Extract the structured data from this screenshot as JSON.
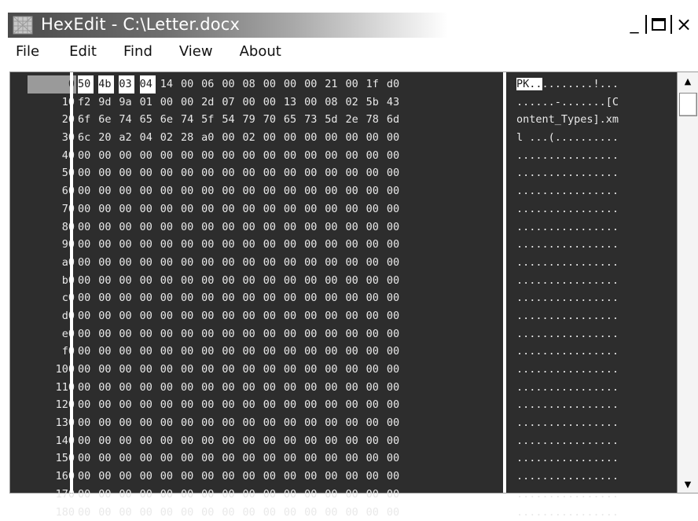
{
  "window": {
    "title": "HexEdit - C:\\Letter.docx",
    "minimize_label": "_",
    "close_label": "×"
  },
  "menu": {
    "items": [
      "File",
      "Edit",
      "Find",
      "View",
      "About"
    ]
  },
  "offsets": [
    "0",
    "10",
    "20",
    "30",
    "40",
    "50",
    "60",
    "70",
    "80",
    "90",
    "a0",
    "b0",
    "c0",
    "d0",
    "e0",
    "f0",
    "100",
    "110",
    "120",
    "130",
    "140",
    "150",
    "160",
    "170",
    "180"
  ],
  "hex_rows": [
    [
      "50",
      "4b",
      "03",
      "04",
      "14",
      "00",
      "06",
      "00",
      "08",
      "00",
      "00",
      "00",
      "21",
      "00",
      "1f",
      "d0"
    ],
    [
      "f2",
      "9d",
      "9a",
      "01",
      "00",
      "00",
      "2d",
      "07",
      "00",
      "00",
      "13",
      "00",
      "08",
      "02",
      "5b",
      "43"
    ],
    [
      "6f",
      "6e",
      "74",
      "65",
      "6e",
      "74",
      "5f",
      "54",
      "79",
      "70",
      "65",
      "73",
      "5d",
      "2e",
      "78",
      "6d"
    ],
    [
      "6c",
      "20",
      "a2",
      "04",
      "02",
      "28",
      "a0",
      "00",
      "02",
      "00",
      "00",
      "00",
      "00",
      "00",
      "00",
      "00"
    ],
    [
      "00",
      "00",
      "00",
      "00",
      "00",
      "00",
      "00",
      "00",
      "00",
      "00",
      "00",
      "00",
      "00",
      "00",
      "00",
      "00"
    ],
    [
      "00",
      "00",
      "00",
      "00",
      "00",
      "00",
      "00",
      "00",
      "00",
      "00",
      "00",
      "00",
      "00",
      "00",
      "00",
      "00"
    ],
    [
      "00",
      "00",
      "00",
      "00",
      "00",
      "00",
      "00",
      "00",
      "00",
      "00",
      "00",
      "00",
      "00",
      "00",
      "00",
      "00"
    ],
    [
      "00",
      "00",
      "00",
      "00",
      "00",
      "00",
      "00",
      "00",
      "00",
      "00",
      "00",
      "00",
      "00",
      "00",
      "00",
      "00"
    ],
    [
      "00",
      "00",
      "00",
      "00",
      "00",
      "00",
      "00",
      "00",
      "00",
      "00",
      "00",
      "00",
      "00",
      "00",
      "00",
      "00"
    ],
    [
      "00",
      "00",
      "00",
      "00",
      "00",
      "00",
      "00",
      "00",
      "00",
      "00",
      "00",
      "00",
      "00",
      "00",
      "00",
      "00"
    ],
    [
      "00",
      "00",
      "00",
      "00",
      "00",
      "00",
      "00",
      "00",
      "00",
      "00",
      "00",
      "00",
      "00",
      "00",
      "00",
      "00"
    ],
    [
      "00",
      "00",
      "00",
      "00",
      "00",
      "00",
      "00",
      "00",
      "00",
      "00",
      "00",
      "00",
      "00",
      "00",
      "00",
      "00"
    ],
    [
      "00",
      "00",
      "00",
      "00",
      "00",
      "00",
      "00",
      "00",
      "00",
      "00",
      "00",
      "00",
      "00",
      "00",
      "00",
      "00"
    ],
    [
      "00",
      "00",
      "00",
      "00",
      "00",
      "00",
      "00",
      "00",
      "00",
      "00",
      "00",
      "00",
      "00",
      "00",
      "00",
      "00"
    ],
    [
      "00",
      "00",
      "00",
      "00",
      "00",
      "00",
      "00",
      "00",
      "00",
      "00",
      "00",
      "00",
      "00",
      "00",
      "00",
      "00"
    ],
    [
      "00",
      "00",
      "00",
      "00",
      "00",
      "00",
      "00",
      "00",
      "00",
      "00",
      "00",
      "00",
      "00",
      "00",
      "00",
      "00"
    ],
    [
      "00",
      "00",
      "00",
      "00",
      "00",
      "00",
      "00",
      "00",
      "00",
      "00",
      "00",
      "00",
      "00",
      "00",
      "00",
      "00"
    ],
    [
      "00",
      "00",
      "00",
      "00",
      "00",
      "00",
      "00",
      "00",
      "00",
      "00",
      "00",
      "00",
      "00",
      "00",
      "00",
      "00"
    ],
    [
      "00",
      "00",
      "00",
      "00",
      "00",
      "00",
      "00",
      "00",
      "00",
      "00",
      "00",
      "00",
      "00",
      "00",
      "00",
      "00"
    ],
    [
      "00",
      "00",
      "00",
      "00",
      "00",
      "00",
      "00",
      "00",
      "00",
      "00",
      "00",
      "00",
      "00",
      "00",
      "00",
      "00"
    ],
    [
      "00",
      "00",
      "00",
      "00",
      "00",
      "00",
      "00",
      "00",
      "00",
      "00",
      "00",
      "00",
      "00",
      "00",
      "00",
      "00"
    ],
    [
      "00",
      "00",
      "00",
      "00",
      "00",
      "00",
      "00",
      "00",
      "00",
      "00",
      "00",
      "00",
      "00",
      "00",
      "00",
      "00"
    ],
    [
      "00",
      "00",
      "00",
      "00",
      "00",
      "00",
      "00",
      "00",
      "00",
      "00",
      "00",
      "00",
      "00",
      "00",
      "00",
      "00"
    ],
    [
      "00",
      "00",
      "00",
      "00",
      "00",
      "00",
      "00",
      "00",
      "00",
      "00",
      "00",
      "00",
      "00",
      "00",
      "00",
      "00"
    ],
    [
      "00",
      "00",
      "00",
      "00",
      "00",
      "00",
      "00",
      "00",
      "00",
      "00",
      "00",
      "00",
      "00",
      "00",
      "00",
      "00"
    ]
  ],
  "ascii_rows": [
    "PK..........!...",
    "......-.......[C",
    "ontent_Types].xm",
    "l ...(..........",
    "................",
    "................",
    "................",
    "................",
    "................",
    "................",
    "................",
    "................",
    "................",
    "................",
    "................",
    "................",
    "................",
    "................",
    "................",
    "................",
    "................",
    "................",
    "................",
    "................",
    "................"
  ],
  "selection": {
    "hex_highlight_count": 4,
    "ascii_highlight_count": 4,
    "selected_offset_row": 0
  },
  "icons": {
    "app": "hexedit-app-icon",
    "scroll_up": "scroll-up-arrow-icon",
    "scroll_down": "scroll-down-arrow-icon"
  },
  "colors": {
    "panel_bg": "#2d2d2d",
    "text": "#e9e9e9",
    "highlight": "#ffffff",
    "offset_selected": "#9a9a9a"
  }
}
